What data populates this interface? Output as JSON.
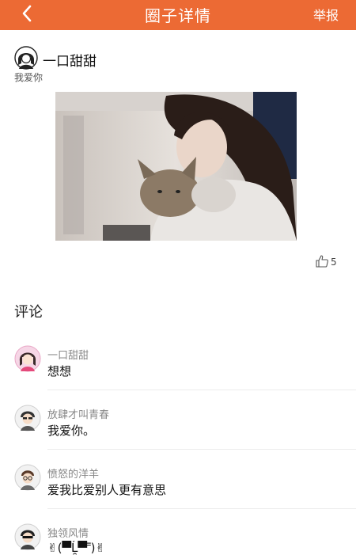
{
  "nav": {
    "title": "圈子详情",
    "report": "举报"
  },
  "post": {
    "author": "一口甜甜",
    "text": "我爱你",
    "likes": "5"
  },
  "comments_title": "评论",
  "comments": [
    {
      "user": "一口甜甜",
      "text": "想想"
    },
    {
      "user": "放肆才叫青春",
      "text": "我爱你。"
    },
    {
      "user": "愤怒的洋羊",
      "text": "爱我比爱别人更有意思"
    },
    {
      "user": "独领风情",
      "text": "✌(▀̿Ĺ̯▀̿ ̿)✌"
    }
  ],
  "colors": {
    "accent": "#ec6a34"
  }
}
